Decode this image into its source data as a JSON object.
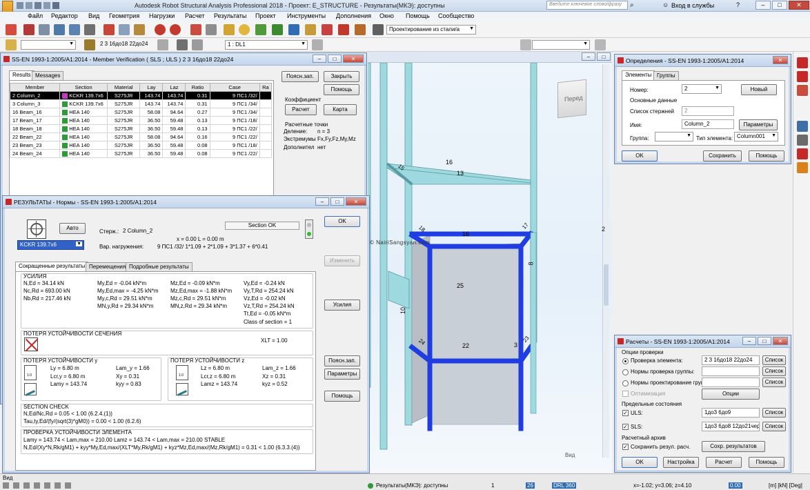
{
  "app": {
    "title": "Autodesk Robot Structural Analysis Professional 2018 - Проект: E_STRUCTURE - Результаты(МКЭ): доступны",
    "search_placeholder": "Введите ключевое слово/фразу",
    "signin": "Вход в службы",
    "menu": [
      "Файл",
      "Редактор",
      "Вид",
      "Геометрия",
      "Нагрузки",
      "Расчет",
      "Результаты",
      "Проект",
      "Инструменты",
      "Дополнения",
      "Окно",
      "Помощь",
      "Сообщество"
    ],
    "design_combo": "Проектирование из стали/а",
    "bar_selection": "2 3 16до18 22до24",
    "load_case": "1 : DL1"
  },
  "verification": {
    "title": "SS-EN 1993-1:2005/A1:2014 - Member Verification ( SLS ; ULS ) 2 3 16до18 22до24",
    "tabs": [
      "Results",
      "Messages"
    ],
    "columns": [
      "Member",
      "Section",
      "Material",
      "Lay",
      "Laz",
      "Ratio",
      "Case",
      "Ra"
    ],
    "rows": [
      {
        "member": "2 Column_2",
        "section": "KCKR 139.7x6",
        "material": "S275JR",
        "lay": "143.74",
        "laz": "143.74",
        "ratio": "0.31",
        "case": "9 ПС1 /32/"
      },
      {
        "member": "3 Column_3",
        "section": "KCKR 139.7x6",
        "material": "S275JR",
        "lay": "143.74",
        "laz": "143.74",
        "ratio": "0.31",
        "case": "9 ПС1 /34/"
      },
      {
        "member": "16 Beam_16",
        "section": "HEA 140",
        "material": "S275JR",
        "lay": "58.08",
        "laz": "94.64",
        "ratio": "0.27",
        "case": "9 ПС1 /34/"
      },
      {
        "member": "17 Beam_17",
        "section": "HEA 140",
        "material": "S275JR",
        "lay": "36.50",
        "laz": "59.48",
        "ratio": "0.13",
        "case": "9 ПС1 /18/"
      },
      {
        "member": "18 Beam_18",
        "section": "HEA 140",
        "material": "S275JR",
        "lay": "36.50",
        "laz": "59.48",
        "ratio": "0.13",
        "case": "9 ПС1 /22/"
      },
      {
        "member": "22 Beam_22",
        "section": "HEA 140",
        "material": "S275JR",
        "lay": "58.08",
        "laz": "94.64",
        "ratio": "0.16",
        "case": "9 ПС1 /22/"
      },
      {
        "member": "23 Beam_23",
        "section": "HEA 140",
        "material": "S275JR",
        "lay": "36.50",
        "laz": "59.48",
        "ratio": "0.08",
        "case": "9 ПС1 /18/"
      },
      {
        "member": "24 Beam_24",
        "section": "HEA 140",
        "material": "S275JR",
        "lay": "36.50",
        "laz": "59.48",
        "ratio": "0.08",
        "case": "9 ПС1 /22/"
      }
    ],
    "btn_notes": "Поясн.зап.",
    "btn_close": "Закрыть",
    "btn_help": "Помощь",
    "coef_label": "Коэффициент",
    "btn_calc": "Расчет",
    "btn_map": "Карта",
    "points_label": "Расчетные точки",
    "division": "Деление:",
    "division_val": "n = 3",
    "extremes": "Экстремумы",
    "extremes_val": "Fx,Fy,Fz,My,Mz",
    "additional": "Дополнител",
    "additional_val": "нет"
  },
  "results": {
    "title": "РЕЗУЛЬТАТЫ - Нормы - SS-EN 1993-1:2005/A1:2014",
    "auto_btn": "Авто",
    "section_combo": "KCKR 139.7x6",
    "bar_label": "Стерж.:",
    "bar_value": "2  Column_2",
    "position": "x = 0.00 L = 0.00 m",
    "load_label": "Вар. нагружения:",
    "load_value": "9 ПС1 /32/  1*1.09 + 2*1.09 + 3*1.37 + 6*0.41",
    "status": "Section OK",
    "btn_ok": "OK",
    "btn_change": "Изменить",
    "btn_forces": "Усилия",
    "btn_notes": "Поясн.зап.",
    "btn_params": "Параметры",
    "btn_help": "Помощь",
    "tabs": [
      "Сокращенные результаты",
      "Перемещения",
      "Подробные результаты"
    ],
    "forces_title": "УСИЛИЯ",
    "forces_col1": [
      "N,Ed = 34.14 kN",
      "Nc,Rd = 693.00 kN",
      "Nb,Rd = 217.46 kN"
    ],
    "forces_col2": [
      "My,Ed = -0.04 kN*m",
      "My,Ed,max = -4.25 kN*m",
      "My,c,Rd = 29.51 kN*m",
      "MN,y,Rd = 29.34 kN*m"
    ],
    "forces_col3": [
      "Mz,Ed = -0.09 kN*m",
      "Mz,Ed,max = -1.88 kN*m",
      "Mz,c,Rd = 29.51 kN*m",
      "MN,z,Rd = 29.34 kN*m"
    ],
    "forces_col4": [
      "Vy,Ed = -0.24 kN",
      "Vy,T,Rd = 254.24 kN",
      "Vz,Ed = -0.02 kN",
      "Vz,T,Rd = 254.24 kN",
      "Tt,Ed = -0.05 kN*m",
      "Class of section = 1"
    ],
    "ltb_title": "ПОТЕРЯ УСТОЙЧИВОСТИ СЕЧЕНИЯ",
    "xlt": "XLT = 1.00",
    "buck_y_title": "ПОТЕРЯ УСТОЙЧИВОСТИ y",
    "buck_y_a": [
      "Ly = 6.80 m",
      "Lcr,y = 6.80 m",
      "Lamy = 143.74"
    ],
    "buck_y_b": [
      "Lam_y = 1.66",
      "Xy = 0.31",
      "kyy = 0.83"
    ],
    "buck_z_title": "ПОТЕРЯ УСТОЙЧИВОСТИ z",
    "buck_z_a": [
      "Lz = 6.80 m",
      "Lcr,z = 6.80 m",
      "Lamz = 143.74"
    ],
    "buck_z_b": [
      "Lam_z = 1.66",
      "Xz = 0.31",
      "kyz = 0.52"
    ],
    "factor": "1.0",
    "check_title": "SECTION CHECK",
    "check_lines": [
      "N,Ed/Nc,Rd = 0.05 < 1.00  (6.2.4.(1))",
      "Tau,ty,Ed/(fy/(sqrt(3)*gM0)) = 0.00 < 1.00  (6.2.6)"
    ],
    "stab_title": "ПРОВЕРКА УСТОЙЧИВОСТИ ЭЛЕМЕНТА",
    "stab_line1": "Lamy = 143.74 < Lam,max = 210.00          Lamz = 143.74 < Lam,max = 210.00    STABLE",
    "stab_line2": "N,Ed/(Xy*N,Rk/gM1) + kyy*My,Ed,max/(XLT*My,Rk/gM1) + kyz*Mz,Ed,max/(Mz,Rk/gM1) = 0.31 < 1.00  (6.3.3.(4))"
  },
  "viewport": {
    "view_cube": "Перед",
    "watermark": "© NairiSangsyan.com",
    "view_label": "Вид",
    "labels": [
      "16",
      "13",
      "15",
      "16",
      "17",
      "18",
      "8",
      "25",
      "10",
      "22",
      "24",
      "3",
      "23"
    ],
    "scroll_value": "2"
  },
  "definitions": {
    "title": "Определения - SS-EN 1993-1:2005/A1:2014",
    "tabs": [
      "Элементы",
      "Группы"
    ],
    "number_label": "Номер:",
    "number_value": "2",
    "btn_new": "Новый",
    "basic_label": "Основные данные",
    "list_label": "Список стержней",
    "list_value": "2",
    "name_label": "Имя:",
    "name_value": "Column_2",
    "btn_params": "Параметры",
    "group_label": "Группа:",
    "type_label": "Тип элемента:",
    "type_value": "Column001",
    "btn_ok": "OK",
    "btn_save": "Сохранить",
    "btn_help": "Помощь"
  },
  "calculations": {
    "title": "Расчеты - SS-EN 1993-1:2005/A1:2014",
    "options_label": "Опции проверки",
    "opt_element": "Проверка элемента:",
    "opt_element_value": "2 3 16до18 22до24",
    "opt_group": "Нормы проверка группы:",
    "opt_design": "Нормы проектирование груп",
    "list_btn": "Список",
    "optimization": "Оптимизация",
    "btn_options": "Опции",
    "limit_label": "Предельные состояния",
    "uls": "ULS:",
    "uls_value": "1до3 6до9",
    "sls": "SLS:",
    "sls_value": "1до3 6до8 12до21чер",
    "archive_label": "Расчетный архив",
    "save_results": "Сохранить резул. расч.",
    "btn_save_results": "Сохр. результатов",
    "btn_ok": "OK",
    "btn_settings": "Настройка",
    "btn_calc": "Расчет",
    "btn_help": "Помощь"
  },
  "status": {
    "left": "Вид",
    "results": "Результаты(МКЭ): доступны",
    "n1": "1",
    "n2": "26",
    "n3": "DRL 360",
    "coords": "x=-1.02; y=3.06; z=4.10",
    "n4": "0.00",
    "units": "[m] [kN] [Deg]"
  },
  "colors": {
    "accent": "#c62828",
    "selection": "#1f3de0",
    "member": "#8fd3dc",
    "panel": "#c9cfd6"
  }
}
